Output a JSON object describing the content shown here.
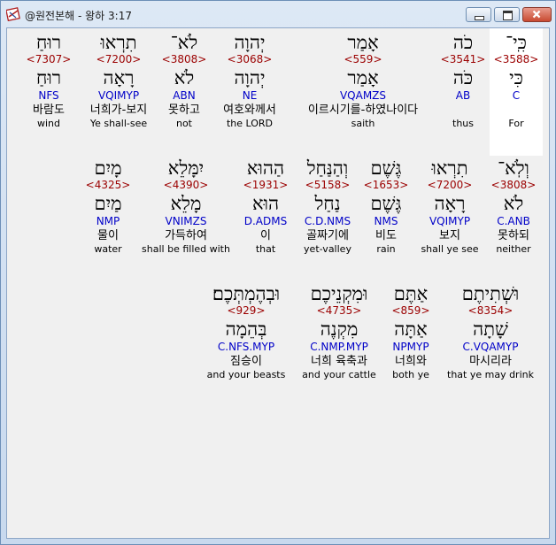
{
  "window": {
    "title": "@원전본해 - 왕하 3:17",
    "buttons": {
      "minimize": "minimize",
      "maximize": "maximize",
      "close": "close"
    }
  },
  "rows": [
    {
      "words": [
        {
          "heb": "כִּֽי־",
          "strong": "<3588>",
          "lemma": "כִּי",
          "parse": "C",
          "kor": "",
          "eng": "For"
        },
        {
          "heb": "כֹה",
          "strong": "<3541>",
          "lemma": "כֹּה",
          "parse": "AB",
          "kor": "",
          "eng": "thus"
        },
        {
          "heb": "אָמַר",
          "strong": "<559>",
          "lemma": "אָמַר",
          "parse": "VQAMZS",
          "kor": "이르시기를-하였나이다",
          "eng": "saith"
        },
        {
          "heb": "יְהוָה",
          "strong": "<3068>",
          "lemma": "יְהוָה",
          "parse": "NE",
          "kor": "여호와께서",
          "eng": "the LORD"
        },
        {
          "heb": "לֹא־",
          "strong": "<3808>",
          "lemma": "לֹא",
          "parse": "ABN",
          "kor": "못하고",
          "eng": "not"
        },
        {
          "heb": "תִרְאוּ",
          "strong": "<7200>",
          "lemma": "רָאָה",
          "parse": "VQIMYP",
          "kor": "너희가-보지",
          "eng": "Ye shall-see"
        },
        {
          "heb": "רוּחַ",
          "strong": "<7307>",
          "lemma": "רוּחַ",
          "parse": "NFS",
          "kor": "바람도",
          "eng": "wind"
        }
      ]
    },
    {
      "words": [
        {
          "heb": "וְלֹֽא־",
          "strong": "<3808>",
          "lemma": "לֹא",
          "parse": "C.ANB",
          "kor": "못하되",
          "eng": "neither"
        },
        {
          "heb": "תִרְאוּ",
          "strong": "<7200>",
          "lemma": "רָאָה",
          "parse": "VQIMYP",
          "kor": "보지",
          "eng": "shall ye see"
        },
        {
          "heb": "גֶּשֶׁם",
          "strong": "<1653>",
          "lemma": "גֶּשֶׁם",
          "parse": "NMS",
          "kor": "비도",
          "eng": "rain"
        },
        {
          "heb": "וְהַנַּחַל",
          "strong": "<5158>",
          "lemma": "נַחַל",
          "parse": "C.D.NMS",
          "kor": "골짜기에",
          "eng": "yet-valley"
        },
        {
          "heb": "הַהוּא",
          "strong": "<1931>",
          "lemma": "הוּא",
          "parse": "D.ADMS",
          "kor": "이",
          "eng": "that"
        },
        {
          "heb": "יִמָּלֵא",
          "strong": "<4390>",
          "lemma": "מָלֵא",
          "parse": "VNIMZS",
          "kor": "가득하여",
          "eng": "shall be filled with"
        },
        {
          "heb": "מָיִם",
          "strong": "<4325>",
          "lemma": "מַיִם",
          "parse": "NMP",
          "kor": "물이",
          "eng": "water"
        }
      ]
    },
    {
      "words": [
        {
          "heb": "וּשְׁתִיתֶם",
          "strong": "<8354>",
          "lemma": "שָׁתָה",
          "parse": "C.VQAMYP",
          "kor": "마시리라",
          "eng": "that ye may drink"
        },
        {
          "heb": "אַתֶּם",
          "strong": "<859>",
          "lemma": "אַתָּה",
          "parse": "NPMYP",
          "kor": "너희와",
          "eng": "both ye"
        },
        {
          "heb": "וּמִקְנֵיכֶם",
          "strong": "<4735>",
          "lemma": "מִקְנֶה",
          "parse": "C.NMP.MYP",
          "kor": "너희 육축과",
          "eng": "and your cattle"
        },
        {
          "heb": "וּבְהֶמְתְּכֶם׃",
          "strong": "<929>",
          "lemma": "בְּהֵמָה",
          "parse": "C.NFS.MYP",
          "kor": "짐승이",
          "eng": "and your beasts"
        }
      ]
    }
  ]
}
